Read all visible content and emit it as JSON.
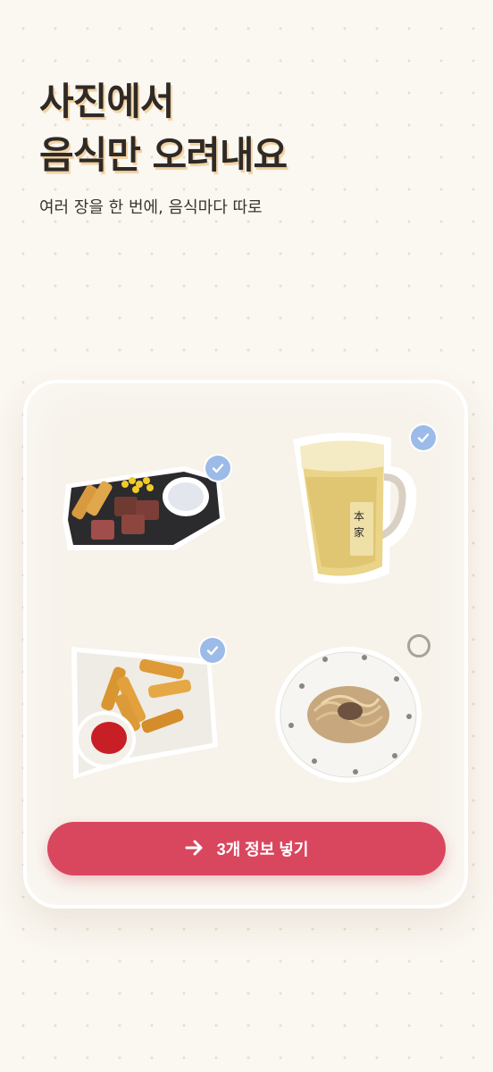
{
  "hero": {
    "title_line1": "사진에서",
    "title_line2": "음식만 오려내요",
    "subtitle": "여러 장을 한 번에, 음식마다 따로"
  },
  "food_items": [
    {
      "name": "steak-plate",
      "selected": true
    },
    {
      "name": "highball-glass",
      "selected": true
    },
    {
      "name": "fried-rolls",
      "selected": true
    },
    {
      "name": "pasta-plate",
      "selected": false
    }
  ],
  "cta": {
    "icon": "arrow-right-icon",
    "label": "3개 정보 넣기"
  },
  "colors": {
    "background": "#fbf7f1",
    "accent": "#d9475f",
    "check_selected": "#9dbbe8",
    "check_unselected": "#a7a29b",
    "title_shadow": "#f2d3a4"
  }
}
